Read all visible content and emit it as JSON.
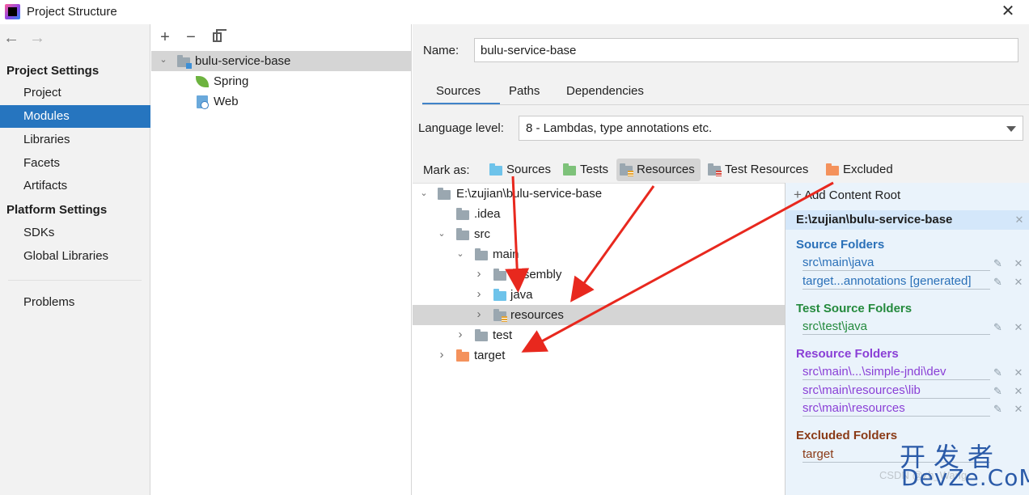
{
  "window": {
    "title": "Project Structure",
    "close_glyph": "✕"
  },
  "nav": {
    "back_glyph": "←",
    "forward_glyph": "→",
    "section_project": "Project Settings",
    "project_items": [
      "Project",
      "Modules",
      "Libraries",
      "Facets",
      "Artifacts"
    ],
    "section_platform": "Platform Settings",
    "platform_items": [
      "SDKs",
      "Global Libraries"
    ],
    "problems": "Problems"
  },
  "modules": {
    "add_glyph": "+",
    "remove_glyph": "−",
    "expand_glyph": "⌄",
    "root": "bulu-service-base",
    "children": [
      "Spring",
      "Web"
    ]
  },
  "details": {
    "name_label": "Name:",
    "name_value": "bulu-service-base",
    "tabs": [
      "Sources",
      "Paths",
      "Dependencies"
    ],
    "language_label": "Language level:",
    "language_value": "8 - Lambdas, type annotations etc.",
    "mark_as_label": "Mark as:",
    "mark_buttons": [
      "Sources",
      "Tests",
      "Resources",
      "Test Resources",
      "Excluded"
    ]
  },
  "tree": {
    "collapsed_glyph": "›",
    "expanded_glyph": "⌄",
    "rows": [
      "E:\\zujian\\bulu-service-base",
      ".idea",
      "src",
      "main",
      "assembly",
      "java",
      "resources",
      "test",
      "target"
    ]
  },
  "roots": {
    "add_label": "Add Content Root",
    "add_glyph": "+",
    "root_path": "E:\\zujian\\bulu-service-base",
    "edit_glyph": "✎",
    "remove_glyph": "✕",
    "source_header": "Source Folders",
    "source_items": [
      "src\\main\\java",
      "target...annotations [generated]"
    ],
    "test_header": "Test Source Folders",
    "test_items": [
      "src\\test\\java"
    ],
    "resource_header": "Resource Folders",
    "resource_items": [
      "src\\main\\...\\simple-jndi\\dev",
      "src\\main\\resources\\lib",
      "src\\main\\resources"
    ],
    "excluded_header": "Excluded Folders",
    "excluded_items": [
      "target"
    ]
  },
  "watermark": {
    "cn": "开发者",
    "en": "DevZe.CoM",
    "faint": "CSDN @zh_Wang"
  },
  "colors": {
    "selection_blue": "#2675bf",
    "source_blue": "#2a70b8",
    "test_green": "#248a3d",
    "resource_purple": "#8a3fd6",
    "excluded_brown": "#8a3a16",
    "annotation_red": "#e8281e"
  }
}
